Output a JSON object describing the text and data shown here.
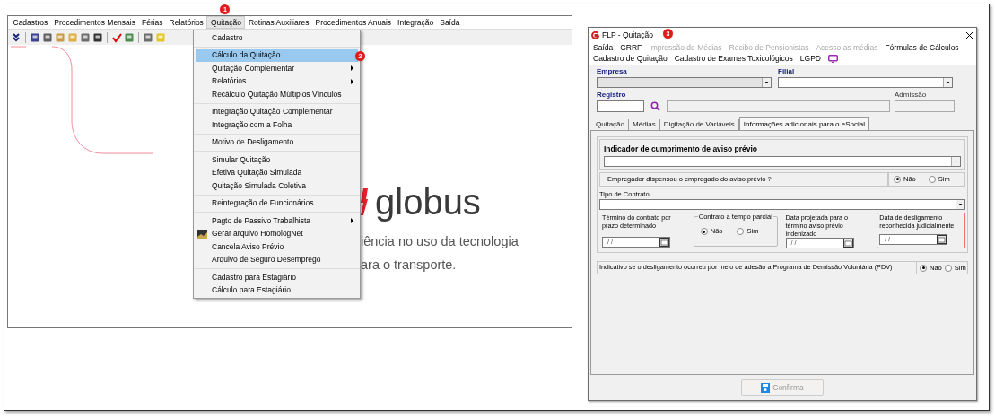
{
  "main_window": {
    "menu_bar": [
      {
        "label": "Cadastros",
        "selected": false
      },
      {
        "label": "Procedimentos Mensais",
        "selected": false
      },
      {
        "label": "Férias",
        "selected": false
      },
      {
        "label": "Relatórios",
        "selected": false
      },
      {
        "label": "Quitação",
        "selected": true,
        "step": "1"
      },
      {
        "label": "Rotinas Auxiliares",
        "selected": false
      },
      {
        "label": "Procedimentos Anuais",
        "selected": false
      },
      {
        "label": "Integração",
        "selected": false
      },
      {
        "label": "Saída",
        "selected": false
      }
    ],
    "splash": {
      "logo_text": "globus",
      "tagline": [
        "iência no uso da tecnologia",
        "ara o transporte."
      ]
    },
    "dropdown_menu": {
      "groups": [
        [
          {
            "label": "Cadastro",
            "selected": false,
            "submenu": false,
            "icon": false
          }
        ],
        [
          {
            "label": "Cálculo da Quitação",
            "selected": true,
            "submenu": false,
            "icon": false,
            "step": "2"
          },
          {
            "label": "Quitação Complementar",
            "selected": false,
            "submenu": true,
            "icon": false
          },
          {
            "label": "Relatórios",
            "selected": false,
            "submenu": true,
            "icon": false
          },
          {
            "label": "Recálculo Quitação Múltiplos Vínculos",
            "selected": false,
            "submenu": false,
            "icon": false
          }
        ],
        [
          {
            "label": "Integração Quitação Complementar",
            "selected": false,
            "submenu": false,
            "icon": false
          },
          {
            "label": "Integração com a Folha",
            "selected": false,
            "submenu": false,
            "icon": false
          }
        ],
        [
          {
            "label": "Motivo de Desligamento",
            "selected": false,
            "submenu": false,
            "icon": false
          }
        ],
        [
          {
            "label": "Simular Quitação",
            "selected": false,
            "submenu": false,
            "icon": false
          },
          {
            "label": "Efetiva Quitação Simulada",
            "selected": false,
            "submenu": false,
            "icon": false
          },
          {
            "label": "Quitação Simulada Coletiva",
            "selected": false,
            "submenu": false,
            "icon": false
          }
        ],
        [
          {
            "label": "Reintegração de Funcionários",
            "selected": false,
            "submenu": false,
            "icon": false
          }
        ],
        [
          {
            "label": "Pagto de Passivo Trabalhista",
            "selected": false,
            "submenu": true,
            "icon": false
          },
          {
            "label": "Gerar arquivo HomologNet",
            "selected": false,
            "submenu": false,
            "icon": true
          },
          {
            "label": "Cancela Aviso Prévio",
            "selected": false,
            "submenu": false,
            "icon": false
          },
          {
            "label": "Arquivo de Seguro Desemprego",
            "selected": false,
            "submenu": false,
            "icon": false
          }
        ],
        [
          {
            "label": "Cadastro para Estagiário",
            "selected": false,
            "submenu": false,
            "icon": false
          },
          {
            "label": "Cálculo para Estagiário",
            "selected": false,
            "submenu": false,
            "icon": false
          }
        ]
      ]
    }
  },
  "dialog": {
    "title": "FLP - Quitação",
    "step": "3",
    "menu_rows": [
      [
        {
          "label": "Saída",
          "disabled": false
        },
        {
          "label": "GRRF",
          "disabled": false
        },
        {
          "label": "Impressão de Médias",
          "disabled": true
        },
        {
          "label": "Recibo de Pensionistas",
          "disabled": true
        },
        {
          "label": "Acesso as médias",
          "disabled": true
        },
        {
          "label": "Fórmulas de Cálculos",
          "disabled": false
        }
      ],
      [
        {
          "label": "Cadastro de Quitação",
          "disabled": false
        },
        {
          "label": "Cadastro de Exames Toxicológicos",
          "disabled": false
        },
        {
          "label": "LGPD",
          "disabled": false
        }
      ]
    ],
    "empresa_label": "Empresa",
    "filial_label": "Filial",
    "registro_label": "Registro",
    "admissao_label": "Admissão",
    "tabs": [
      {
        "label": "Quitação",
        "selected": false
      },
      {
        "label": "Médias",
        "selected": false
      },
      {
        "label": "Digitação de Variáveis",
        "selected": false
      },
      {
        "label": "Informações adicionais para o eSocial",
        "selected": true
      }
    ],
    "aviso_group": {
      "title": "Indicador de cumprimento de aviso prévio",
      "question": "Empregador dispensou o empregado do aviso prévio ?",
      "options": [
        {
          "label": "Não",
          "selected": true
        },
        {
          "label": "Sim",
          "selected": false
        }
      ]
    },
    "tipo_contrato_label": "Tipo de Contrato",
    "date_row": [
      {
        "kind": "date",
        "label": "Término do contrato por prazo determinado",
        "value": "/ /",
        "highlighted": false
      },
      {
        "kind": "radio_group",
        "label": "Contrato a tempo parcial",
        "options": [
          {
            "label": "Não",
            "selected": true
          },
          {
            "label": "Sim",
            "selected": false
          }
        ]
      },
      {
        "kind": "date",
        "label": "Data projetada para o término aviso prévio indenizado",
        "value": "/ /",
        "highlighted": false
      },
      {
        "kind": "date",
        "label": "Data de desligamento reconhecida judicialmente",
        "value": "/ /",
        "highlighted": true
      }
    ],
    "pdv": {
      "question": "Indicativo se o desligamento ocorreu por meio de adesão a Programa de Demissão Voluntária (PDV)",
      "options": [
        {
          "label": "Não",
          "selected": true
        },
        {
          "label": "Sim",
          "selected": false
        }
      ]
    },
    "confirm_button": {
      "label": "Confirma",
      "disabled": true
    }
  }
}
